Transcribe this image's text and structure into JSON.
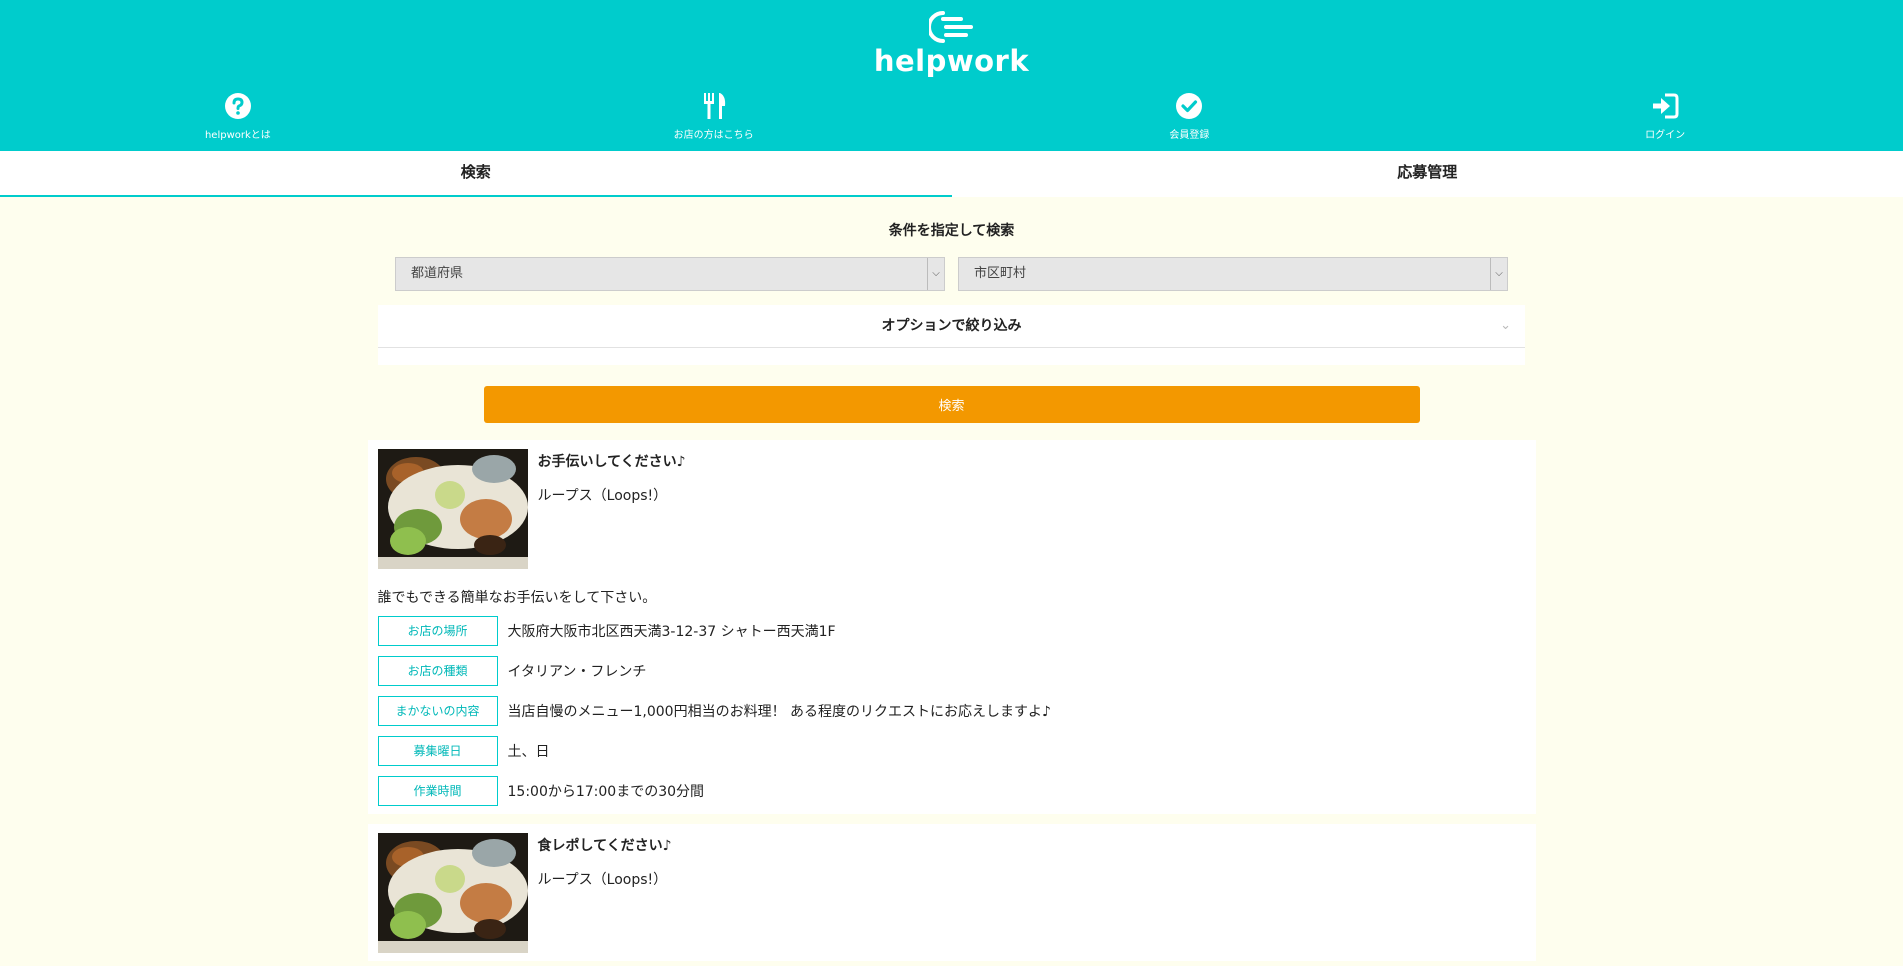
{
  "brand": {
    "name": "helpwork",
    "color": "#00cccc",
    "accent": "#f39800"
  },
  "nav": [
    {
      "label": "helpworkとは",
      "icon": "question-circle-icon"
    },
    {
      "label": "お店の方はこちら",
      "icon": "fork-knife-icon"
    },
    {
      "label": "会員登録",
      "icon": "check-circle-icon"
    },
    {
      "label": "ログイン",
      "icon": "login-icon"
    }
  ],
  "tabs": [
    {
      "label": "検索",
      "active": true
    },
    {
      "label": "応募管理",
      "active": false
    }
  ],
  "search": {
    "title": "条件を指定して検索",
    "prefecture": "都道府県",
    "city": "市区町村",
    "options_label": "オプションで絞り込み",
    "button": "検索"
  },
  "results": [
    {
      "title": "お手伝いしてください♪",
      "shop": "ループス（Loops!）",
      "description": "誰でもできる簡単なお手伝いをして下さい。",
      "rows": [
        {
          "label": "お店の場所",
          "value": "大阪府大阪市北区西天満3-12-37 シャトー西天満1F"
        },
        {
          "label": "お店の種類",
          "value": "イタリアン・フレンチ"
        },
        {
          "label": "まかないの内容",
          "value": "当店自慢のメニュー1,000円相当のお料理！ ある程度のリクエストにお応えしますよ♪"
        },
        {
          "label": "募集曜日",
          "value": "土、日"
        },
        {
          "label": "作業時間",
          "value": "15:00から17:00までの30分間"
        }
      ]
    },
    {
      "title": "食レポしてください♪",
      "shop": "ループス（Loops!）"
    }
  ]
}
